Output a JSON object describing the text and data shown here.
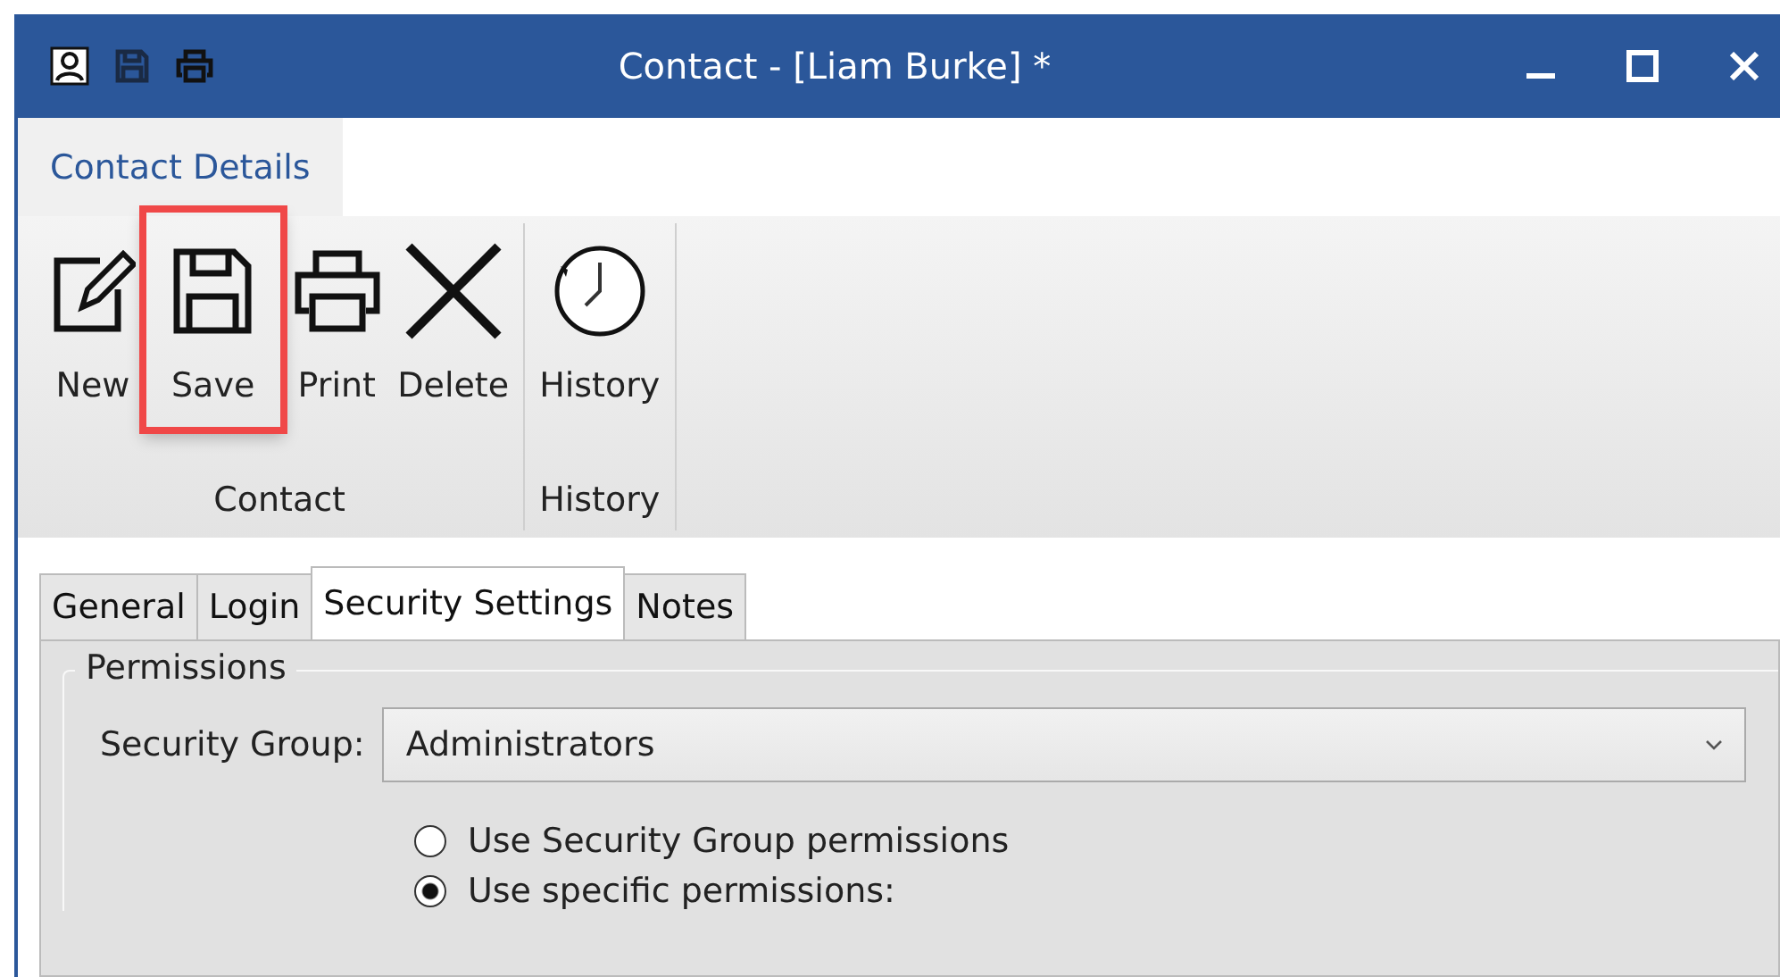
{
  "window": {
    "title": "Contact - [Liam Burke] *"
  },
  "ribbon": {
    "tabs": [
      {
        "label": "Contact Details",
        "selected": true
      }
    ],
    "groups": [
      {
        "label": "Contact",
        "buttons": [
          {
            "label": "New",
            "kind": "new",
            "highlighted": false
          },
          {
            "label": "Save",
            "kind": "save",
            "highlighted": true
          },
          {
            "label": "Print",
            "kind": "print",
            "highlighted": false
          },
          {
            "label": "Delete",
            "kind": "delete",
            "highlighted": false
          }
        ]
      },
      {
        "label": "History",
        "buttons": [
          {
            "label": "History",
            "kind": "history",
            "highlighted": false
          }
        ]
      }
    ]
  },
  "tabs": [
    {
      "label": "General",
      "selected": false
    },
    {
      "label": "Login",
      "selected": false
    },
    {
      "label": "Security Settings",
      "selected": true
    },
    {
      "label": "Notes",
      "selected": false
    }
  ],
  "permissions": {
    "legend": "Permissions",
    "security_group_label": "Security Group:",
    "security_group_value": "Administrators",
    "options": [
      {
        "label": "Use Security Group permissions",
        "selected": false
      },
      {
        "label": "Use specific permissions:",
        "selected": true
      }
    ]
  }
}
